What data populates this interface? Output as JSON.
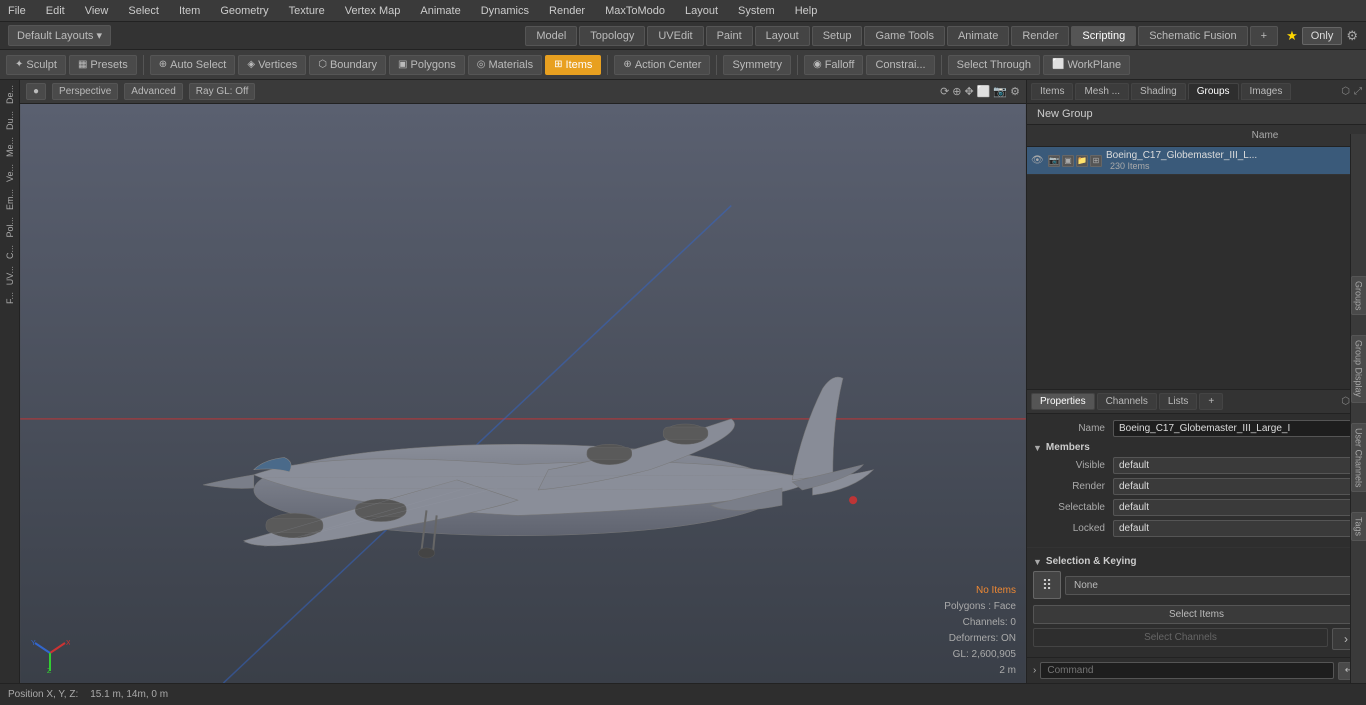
{
  "menu": {
    "items": [
      "File",
      "Edit",
      "View",
      "Select",
      "Item",
      "Geometry",
      "Texture",
      "Vertex Map",
      "Animate",
      "Dynamics",
      "Render",
      "MaxToModo",
      "Layout",
      "System",
      "Help"
    ]
  },
  "layouts_bar": {
    "default_layouts": "Default Layouts ▾",
    "tabs": [
      "Model",
      "Topology",
      "UVEdit",
      "Paint",
      "Layout",
      "Setup",
      "Game Tools",
      "Animate",
      "Render",
      "Scripting",
      "Schematic Fusion"
    ],
    "active_tab": "Scripting",
    "add_btn": "+",
    "star_btn": "★",
    "only_btn": "Only",
    "gear_btn": "⚙"
  },
  "mode_bar": {
    "sculpt": "Sculpt",
    "presets": "Presets",
    "auto_select": "Auto Select",
    "vertices": "Vertices",
    "boundary": "Boundary",
    "polygons": "Polygons",
    "materials": "Materials",
    "items": "Items",
    "action_center": "Action Center",
    "symmetry": "Symmetry",
    "falloff": "Falloff",
    "constraints": "Constrai...",
    "select_through": "Select Through",
    "workplane": "WorkPlane"
  },
  "viewport": {
    "perspective": "Perspective",
    "advanced": "Advanced",
    "ray_gl": "Ray GL: Off"
  },
  "left_toolbar": {
    "items": [
      "De...",
      "Du...",
      "Me...",
      "Ve...",
      "Em...",
      "Pol...",
      "C...",
      "UV...",
      "F..."
    ]
  },
  "vp_info": {
    "no_items": "No Items",
    "polygons": "Polygons : Face",
    "channels": "Channels: 0",
    "deformers": "Deformers: ON",
    "gl": "GL: 2,600,905",
    "distance": "2 m"
  },
  "status_bar": {
    "position": "Position X, Y, Z:",
    "coords": "15.1 m, 14m, 0 m"
  },
  "right_panel": {
    "top_tabs": [
      "Items",
      "Mesh ...",
      "Shading",
      "Groups",
      "Images"
    ],
    "active_top_tab": "Groups",
    "new_group": "New Group",
    "group_list": {
      "columns": [
        "",
        "",
        "",
        "Name"
      ],
      "items": [
        {
          "name": "Boeing_C17_Globemaster_III_L...",
          "count": "230 Items",
          "visible": true
        }
      ]
    }
  },
  "properties": {
    "tabs": [
      "Properties",
      "Channels",
      "Lists"
    ],
    "active_tab": "Properties",
    "name_label": "Name",
    "name_value": "Boeing_C17_Globemaster_III_Large_I",
    "members_section": "Members",
    "visible_label": "Visible",
    "visible_value": "default",
    "render_label": "Render",
    "render_value": "default",
    "selectable_label": "Selectable",
    "selectable_value": "default",
    "locked_label": "Locked",
    "locked_value": "default",
    "sel_keying_section": "Selection & Keying",
    "none_btn": "None",
    "select_items_btn": "Select Items",
    "select_channels_btn": "Select Channels",
    "forward_btn": "›"
  },
  "command_bar": {
    "toggle": "›",
    "placeholder": "Command"
  },
  "vertical_labels": [
    "Groups",
    "Group Display",
    "User Channels",
    "Tags"
  ]
}
